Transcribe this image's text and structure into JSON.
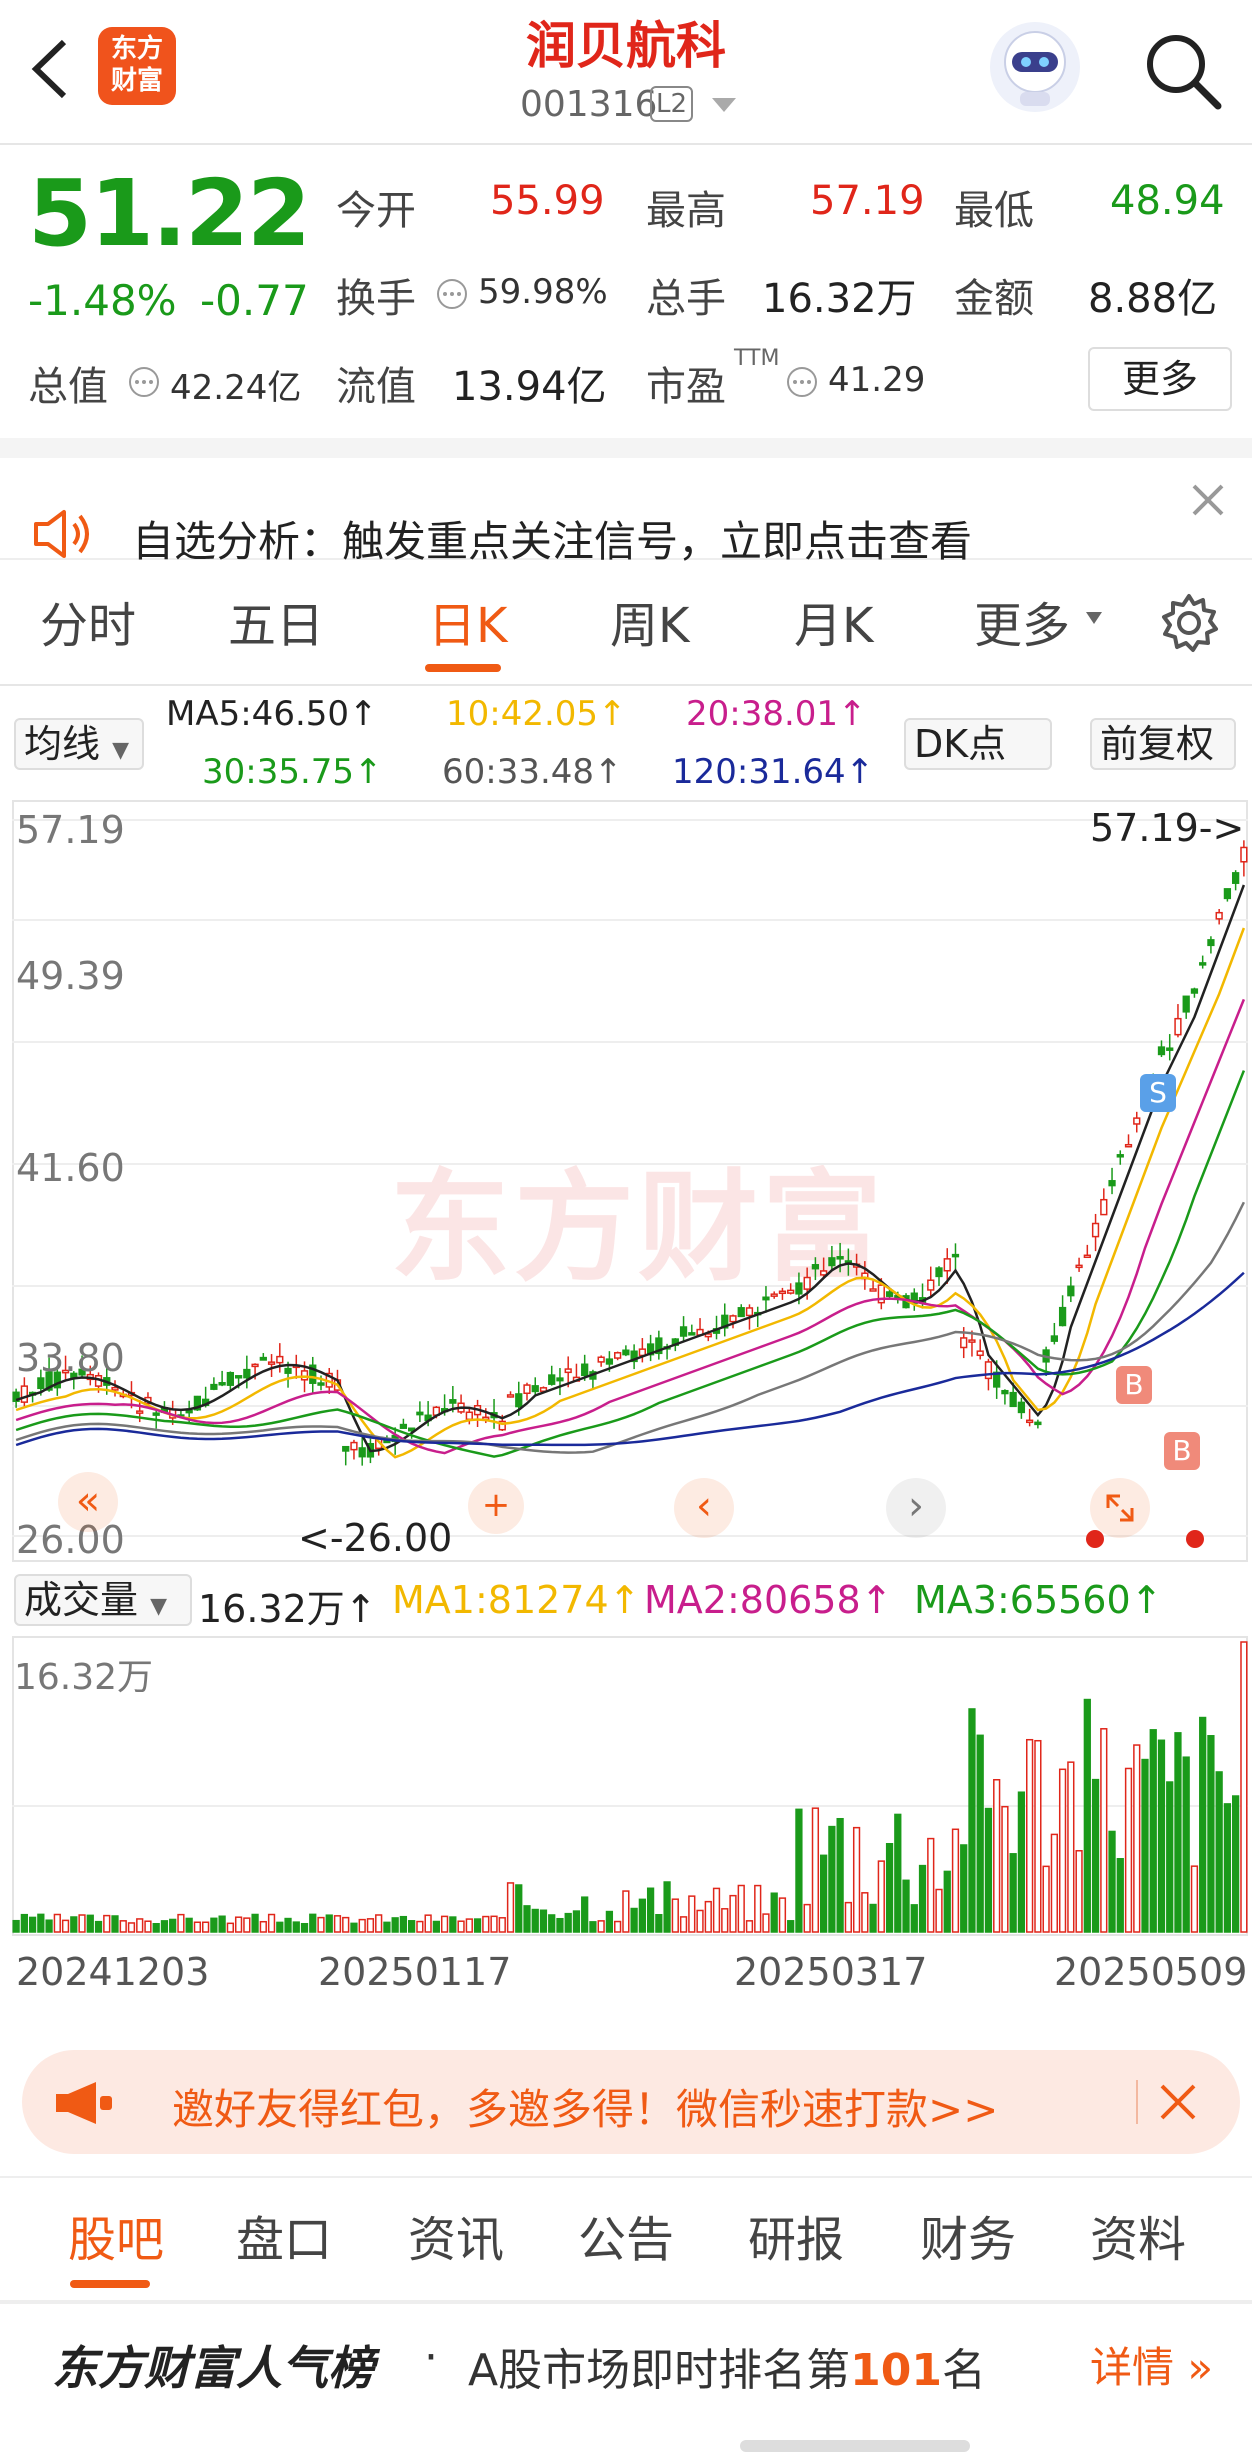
{
  "header": {
    "title": "润贝航科",
    "code": "001316",
    "level": "L2",
    "logo": "东方\n财富",
    "logo_l1": "东方",
    "logo_l2": "财富"
  },
  "quote": {
    "price": "51.22",
    "pct": "-1.48%",
    "chg": "-0.77",
    "open_label": "今开",
    "open": "55.99",
    "high_label": "最高",
    "high": "57.19",
    "low_label": "最低",
    "low": "48.94",
    "turnover_label": "换手",
    "turnover": "59.98%",
    "volume_label": "总手",
    "volume": "16.32万",
    "amount_label": "金额",
    "amount": "8.88亿",
    "mcap_label": "总值",
    "mcap": "42.24亿",
    "float_label": "流值",
    "float": "13.94亿",
    "pe_label": "市盈",
    "pe_sup": "TTM",
    "pe": "41.29",
    "more": "更多"
  },
  "notice": {
    "text": "自选分析：触发重点关注信号，立即点击查看"
  },
  "tabs": [
    "分时",
    "五日",
    "日K",
    "周K",
    "月K",
    "更多"
  ],
  "active_tab": "日K",
  "ma_bar": {
    "selector": "均线",
    "dk": "DK点",
    "adjust": "前复权",
    "ma5": "MA5:46.50↑",
    "ma10": "10:42.05↑",
    "ma20": "20:38.01↑",
    "ma30": "30:35.75↑",
    "ma60": "60:33.48↑",
    "ma120": "120:31.64↑"
  },
  "colors": {
    "up": "#e0261a",
    "down": "#1a9a1a",
    "accent": "#f05a14",
    "ma5": "#222222",
    "ma10": "#f2b800",
    "ma20": "#c81e8c",
    "ma30": "#1a9a1a",
    "ma60": "#777777",
    "ma120": "#1a2a9a"
  },
  "chart": {
    "y_labels": [
      "57.19",
      "49.39",
      "41.60",
      "33.80",
      "26.00"
    ],
    "high_mark": "57.19->",
    "low_mark": "<-26.00",
    "watermark": "东方财富",
    "signal_s": "S",
    "signal_b": "B"
  },
  "volume": {
    "selector": "成交量",
    "value": "16.32万↑",
    "ma1": "MA1:81274↑",
    "ma2": "MA2:80658↑",
    "ma3": "MA3:65560↑",
    "y_label": "16.32万",
    "dates": [
      "20241203",
      "20250117",
      "20250317",
      "20250509"
    ]
  },
  "banner": {
    "text": "邀好友得红包，多邀多得！微信秒速打款>>"
  },
  "bottom_tabs": [
    "股吧",
    "盘口",
    "资讯",
    "公告",
    "研报",
    "财务",
    "资料"
  ],
  "rank": {
    "title": "东方财富人气榜",
    "dot": "·",
    "text_pre": "A股市场即时排名第",
    "num": "101",
    "text_post": "名",
    "detail": "详情"
  }
}
